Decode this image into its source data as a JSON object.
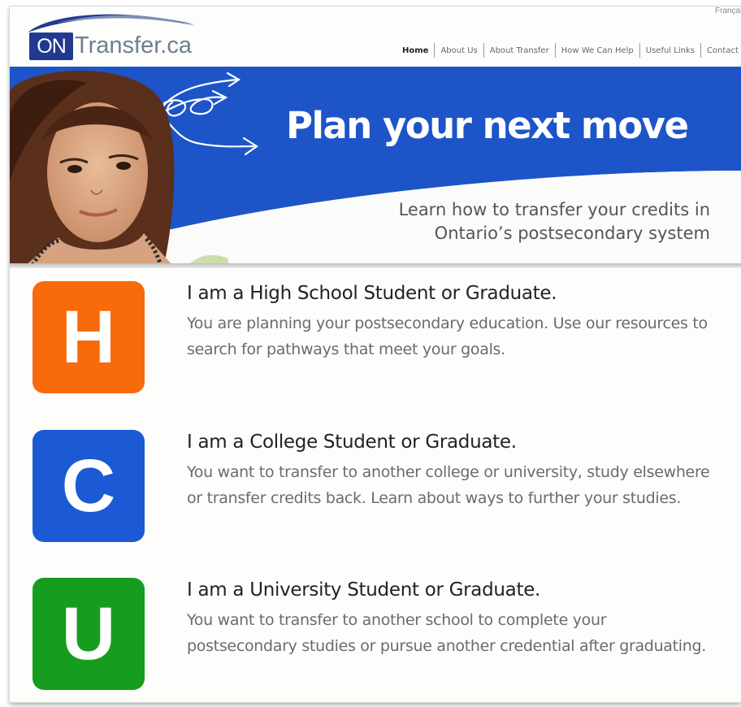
{
  "header": {
    "language_link": "Français",
    "logo": {
      "on": "ON",
      "transfer": "Transfer.ca"
    },
    "nav": [
      {
        "label": "Home",
        "active": true
      },
      {
        "label": "About Us",
        "active": false
      },
      {
        "label": "About Transfer",
        "active": false
      },
      {
        "label": "How We Can Help",
        "active": false
      },
      {
        "label": "Useful Links",
        "active": false
      },
      {
        "label": "Contact Us",
        "active": false
      }
    ]
  },
  "hero": {
    "title": "Plan your next move",
    "subtitle_line1": "Learn how to transfer your credits in",
    "subtitle_line2": "Ontario’s postsecondary system"
  },
  "cards": [
    {
      "letter": "H",
      "color": "#f96a0a",
      "title": "I am a High School Student or Graduate.",
      "desc_line1": "You are planning your postsecondary education. Use our resources to",
      "desc_line2": "search for pathways that meet your goals."
    },
    {
      "letter": "C",
      "color": "#1b5ad4",
      "title": "I am a College Student or Graduate.",
      "desc_line1": "You want to transfer to another college or university, study elsewhere",
      "desc_line2": "or transfer credits back. Learn about ways to further your studies."
    },
    {
      "letter": "U",
      "color": "#169c1e",
      "title": "I am a University Student or Graduate.",
      "desc_line1": "You want to transfer to another school to complete your",
      "desc_line2": "postsecondary studies or pursue another credential after graduating."
    }
  ],
  "colors": {
    "brand_blue": "#1d55c8",
    "logo_navy": "#213a8f"
  }
}
